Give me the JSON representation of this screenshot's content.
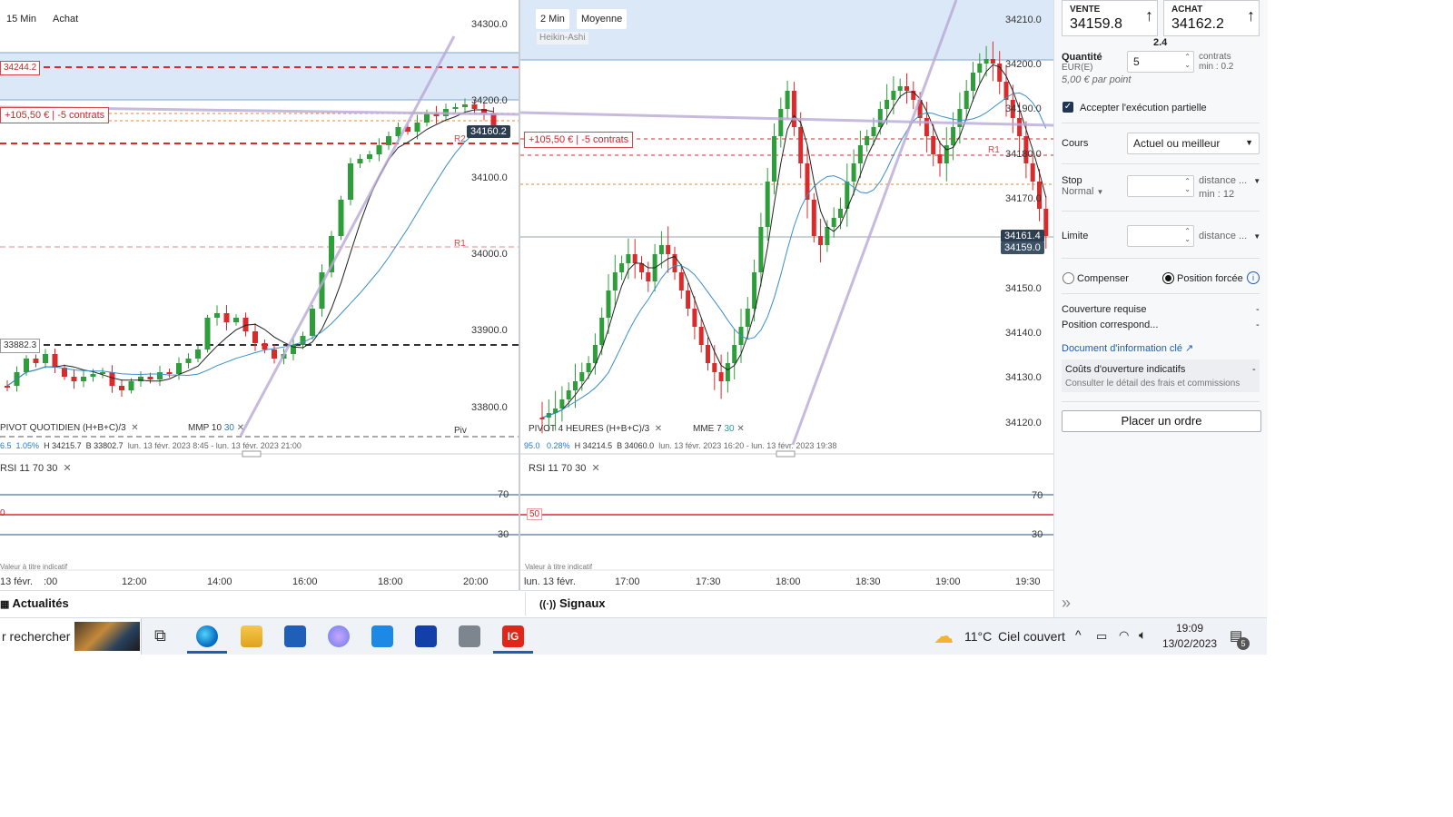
{
  "left_chart": {
    "timeframe": "15 Min",
    "mode": "Achat",
    "price_levels": [
      "34300.0",
      "34200.0",
      "34100.0",
      "34000.0",
      "33900.0",
      "33800.0"
    ],
    "tag_upper": "34244.2",
    "tag_lower": "33882.3",
    "position_tag": "+105,50 €  |  -5 contrats",
    "r2_label": "R2",
    "r1_label": "R1",
    "piv_label": "Piv",
    "current_price": "34160.2",
    "legend_pivot": "PIVOT  QUOTIDIEN  (H+B+C)/3",
    "legend_mm": "MMP  10",
    "legend_mm2": "30",
    "stats_change": "6.5",
    "stats_pct": "1.05%",
    "stats_high": "H 34215.7",
    "stats_low": "B 33802.7",
    "stats_range": "lun. 13 févr. 2023 8:45 - lun. 13 févr. 2023 21:00",
    "rsi_legend": "RSI  11  70  30",
    "rsi_70": "70",
    "rsi_50": "0",
    "rsi_30": "30",
    "indicative": "Valeur à titre indicatif",
    "time_labels": [
      "13 févr.",
      ":00",
      "12:00",
      "14:00",
      "16:00",
      "18:00",
      "20:00"
    ]
  },
  "right_chart": {
    "timeframe": "2 Min",
    "mode": "Moyenne",
    "style": "Heikin-Ashi",
    "price_levels": [
      "34210.0",
      "34200.0",
      "34190.0",
      "34180.0",
      "34170.0",
      "34150.0",
      "34140.0",
      "34130.0",
      "34120.0"
    ],
    "position_tag": "+105,50 €  |  -5 contrats",
    "r1_label": "R1",
    "current_price": "34161.4",
    "current_price2": "34159.0",
    "legend_pivot": "PIVOT  4 HEURES  (H+B+C)/3",
    "legend_mm": "MME  7",
    "legend_mm2": "30",
    "stats_change": "95.0",
    "stats_pct": "0.28%",
    "stats_high": "H 34214.5",
    "stats_low": "B 34060.0",
    "stats_range": "lun. 13 févr. 2023 16:20 - lun. 13 févr. 2023 19:38",
    "rsi_legend": "RSI  11  70  30",
    "rsi_70": "70",
    "rsi_50": "50",
    "rsi_30": "30",
    "indicative": "Valeur à titre indicatif",
    "time_labels": [
      "lun. 13 févr.",
      "17:00",
      "17:30",
      "18:00",
      "18:30",
      "19:00",
      "19:30"
    ]
  },
  "bottom_tabs": {
    "news": "Actualités",
    "signals": "Signaux"
  },
  "order_panel": {
    "sell_label": "VENTE",
    "sell_price": "34159.8",
    "buy_label": "ACHAT",
    "buy_price": "34162.2",
    "spread": "2.4",
    "qty_label": "Quantité",
    "qty_currency": "EUR(E)",
    "qty_value": "5",
    "qty_unit": "contrats",
    "qty_min": "min : 0.2",
    "per_point": "5,00 € par point",
    "partial_label": "Accepter l'exécution partielle",
    "cours_label": "Cours",
    "cours_value": "Actuel ou meilleur",
    "stop_label": "Stop",
    "stop_type": "Normal",
    "stop_distance": "distance ...",
    "stop_min": "min : 12",
    "limit_label": "Limite",
    "limit_distance": "distance ...",
    "compensate_label": "Compenser",
    "forced_label": "Position forcée",
    "coverage_label": "Couverture requise",
    "coverage_value": "-",
    "position_label": "Position correspond...",
    "position_value": "-",
    "doc_link": "Document d'information clé",
    "costs_label": "Coûts d'ouverture indicatifs",
    "costs_value": "-",
    "costs_detail": "Consulter le détail des frais et commissions",
    "place_order": "Placer un ordre"
  },
  "taskbar": {
    "search": "r rechercher",
    "weather_temp": "11°C",
    "weather_desc": "Ciel couvert",
    "time": "19:09",
    "date": "13/02/2023",
    "notif_count": "5",
    "ig_label": "IG"
  },
  "colors": {
    "bull": "#2e9e3a",
    "bear": "#d92b2b",
    "zone": "#dbe8f7",
    "accent": "#1a5fb4"
  }
}
